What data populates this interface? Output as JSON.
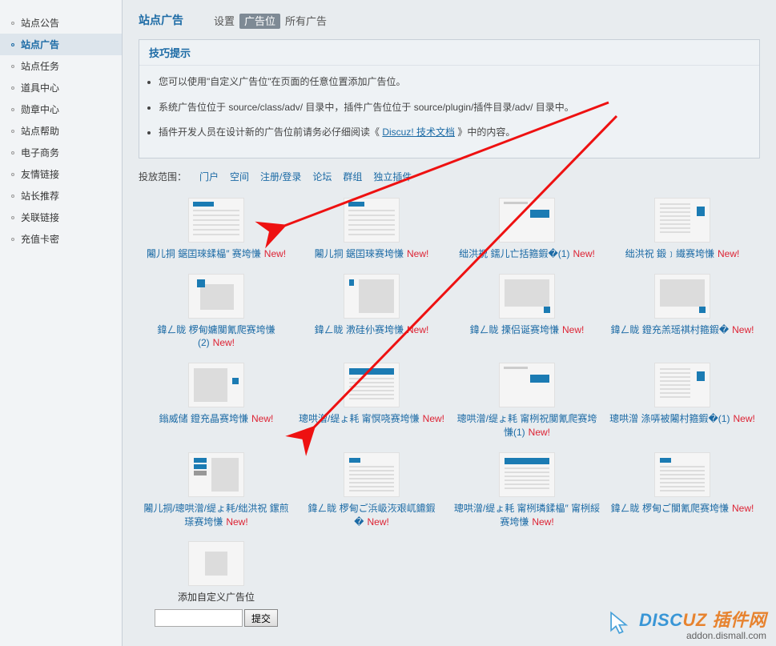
{
  "sidebar": [
    {
      "label": "站点公告"
    },
    {
      "label": "站点广告",
      "active": true
    },
    {
      "label": "站点任务"
    },
    {
      "label": "道具中心"
    },
    {
      "label": "勋章中心"
    },
    {
      "label": "站点帮助"
    },
    {
      "label": "电子商务"
    },
    {
      "label": "友情链接"
    },
    {
      "label": "站长推荐"
    },
    {
      "label": "关联链接"
    },
    {
      "label": "充值卡密"
    }
  ],
  "tabs": {
    "title": "站点广告",
    "items": [
      {
        "label": "设置"
      },
      {
        "label": "广告位",
        "active": true
      },
      {
        "label": "所有广告"
      }
    ]
  },
  "tips": {
    "title": "技巧提示",
    "items": [
      "您可以使用\"自定义广告位\"在页面的任意位置添加广告位。",
      "系统广告位位于 source/class/adv/ 目录中，插件广告位位于 source/plugin/插件目录/adv/ 目录中。",
      {
        "pre": "插件开发人员在设计新的广告位前请务必仔细阅读《 ",
        "link": "Discuz! 技术文档",
        "post": " 》中的内容。"
      }
    ]
  },
  "scope": {
    "label": "投放范围：",
    "items": [
      "门户",
      "空间",
      "注册/登录",
      "论坛",
      "群组",
      "独立插件"
    ]
  },
  "ads": [
    {
      "t": "t1",
      "label": "闂儿挏 鋸囯琜鍒橸″ 赛垮慊",
      "new": true
    },
    {
      "t": "t2",
      "label": "闂儿挏 鋸囯琜赛垮慊",
      "new": true
    },
    {
      "t": "t3",
      "label": "绌洪祝 鑐儿亡括箍鍜�(1)",
      "new": true
    },
    {
      "t": "t4",
      "label": "绌洪祝 鍛﹞繊赛垮慊",
      "new": true
    },
    {
      "t": "t5",
      "label": "鍏ㄥ眬 椤甸嫞闃氰爬赛垮慊(2)",
      "new": true
    },
    {
      "t": "t6",
      "label": "鍏ㄥ眬 漖硅仦赛垮慊",
      "new": true
    },
    {
      "t": "t7",
      "label": "鍏ㄥ眬 搮侣诞赛垮慊",
      "new": true
    },
    {
      "t": "t7",
      "label": "鍏ㄥ眬 鐙充羔瑶褀村箍鍜�",
      "new": true
    },
    {
      "t": "t8",
      "label": "鎓威储 鐙充晶赛垮慊",
      "new": true
    },
    {
      "t": "t9",
      "label": "璁哄潧/缇ょ耗 甯慏哓赛垮慊",
      "new": true
    },
    {
      "t": "t3",
      "label": "璁哄潧/缇ょ耗 甯栵祝闃氰爬赛垮慊(1)",
      "new": true
    },
    {
      "t": "t4",
      "label": "璁哄潧 涤哢被闂村箍鍜�(1)",
      "new": true
    },
    {
      "t": "t10",
      "label": "闂儿挏/璁哄潧/缇ょ耗/绌洪祝 鏍煎瑹赛垮慊",
      "new": true
    },
    {
      "t": "t11",
      "label": "鍏ㄥ眬 椤甸ご浜岋洃艰屼鐤鍜�",
      "new": true
    },
    {
      "t": "t9",
      "label": "璁哄潧/缇ょ耗 甯栵璘鍒橸″ 甯栵綏赛垮慊",
      "new": true
    },
    {
      "t": "t11",
      "label": "鍏ㄥ眬 椤甸ご闃氰爬赛垮慊",
      "new": true
    }
  ],
  "add": {
    "label": "添加自定义广告位",
    "btn": "提交"
  },
  "watermark": {
    "brand1": "DISC",
    "brand2": "UZ 插件网",
    "sub": "addon.dismall.com"
  }
}
